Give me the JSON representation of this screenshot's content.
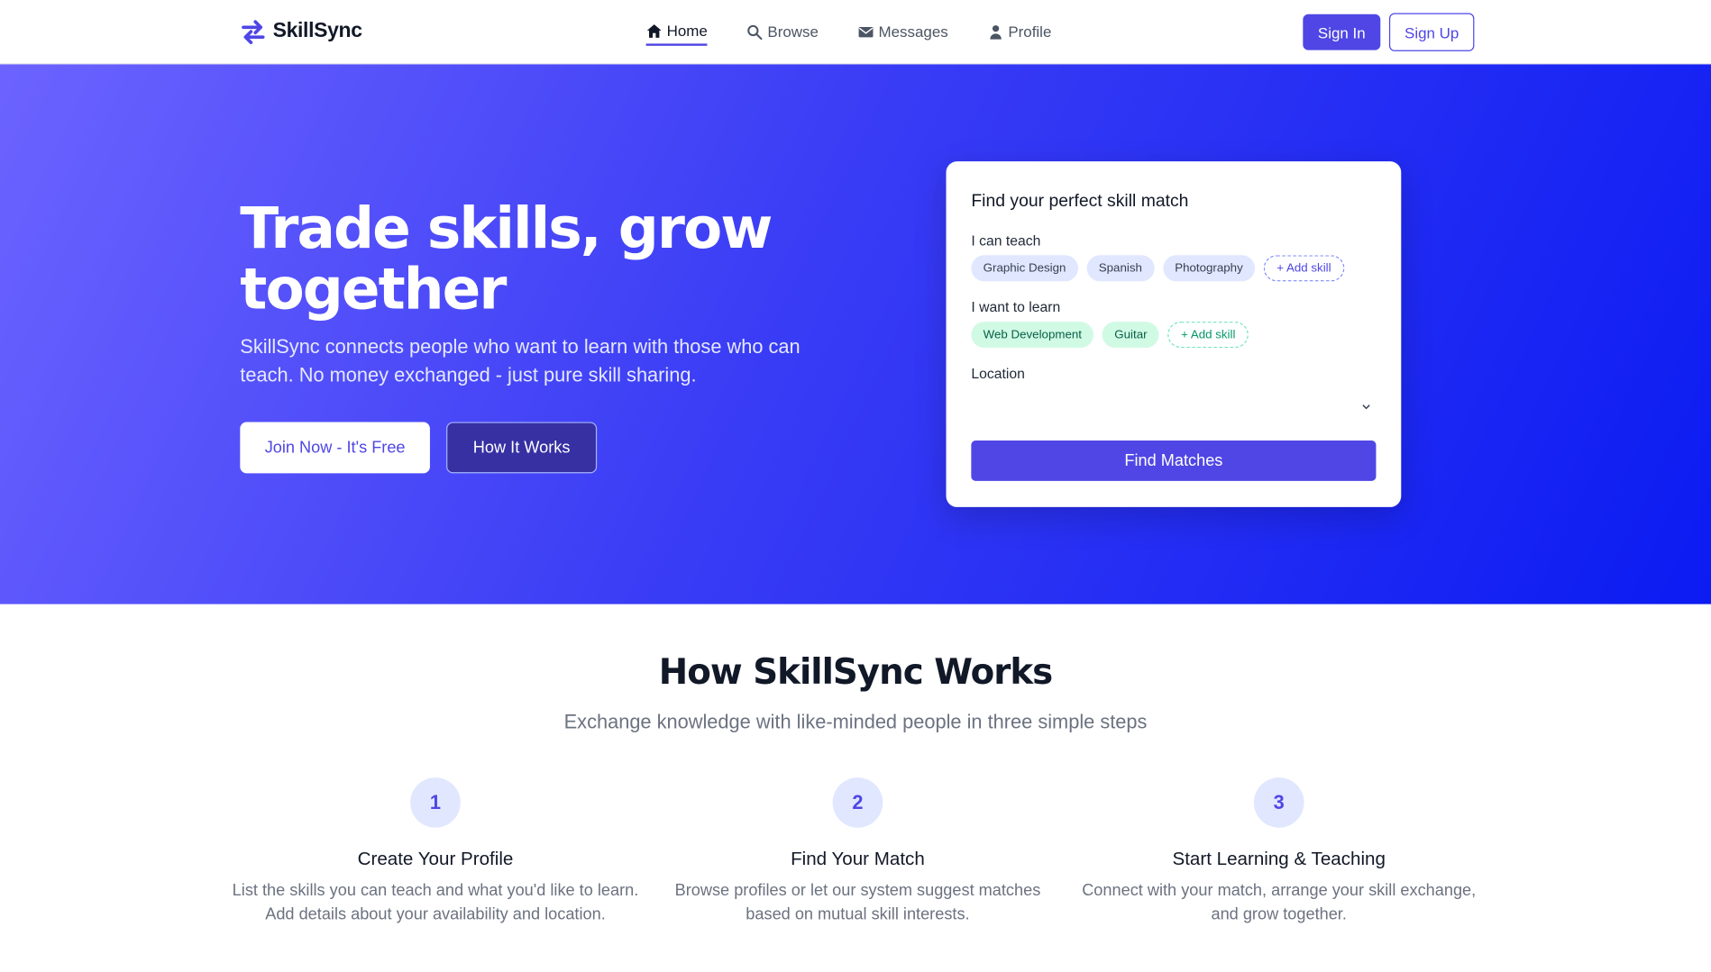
{
  "brand": {
    "name": "SkillSync",
    "accent": "#4f46e5"
  },
  "nav": {
    "items": [
      {
        "label": "Home",
        "icon": "home-icon",
        "active": true
      },
      {
        "label": "Browse",
        "icon": "search-icon",
        "active": false
      },
      {
        "label": "Messages",
        "icon": "envelope-icon",
        "active": false
      },
      {
        "label": "Profile",
        "icon": "user-icon",
        "active": false
      }
    ],
    "sign_in": "Sign In",
    "sign_up": "Sign Up"
  },
  "hero": {
    "title_line1": "Trade skills, grow",
    "title_line2": "together",
    "subtitle": "SkillSync connects people who want to learn with those who can teach. No money exchanged - just pure skill sharing.",
    "join_button": "Join Now - It's Free",
    "how_button": "How It Works"
  },
  "match_card": {
    "title": "Find your perfect skill match",
    "teach_label": "I can teach",
    "teach_skills": [
      "Graphic Design",
      "Spanish",
      "Photography"
    ],
    "teach_add": "+ Add skill",
    "learn_label": "I want to learn",
    "learn_skills": [
      "Web Development",
      "Guitar"
    ],
    "learn_add": "+ Add skill",
    "location_label": "Location",
    "location_value": "",
    "find_button": "Find Matches"
  },
  "how_it_works": {
    "title": "How SkillSync Works",
    "subtitle": "Exchange knowledge with like-minded people in three simple steps",
    "steps": [
      {
        "number": "1",
        "title": "Create Your Profile",
        "description": "List the skills you can teach and what you'd like to learn. Add details about your availability and location."
      },
      {
        "number": "2",
        "title": "Find Your Match",
        "description": "Browse profiles or let our system suggest matches based on mutual skill interests."
      },
      {
        "number": "3",
        "title": "Start Learning & Teaching",
        "description": "Connect with your match, arrange your skill exchange, and grow together."
      }
    ]
  }
}
